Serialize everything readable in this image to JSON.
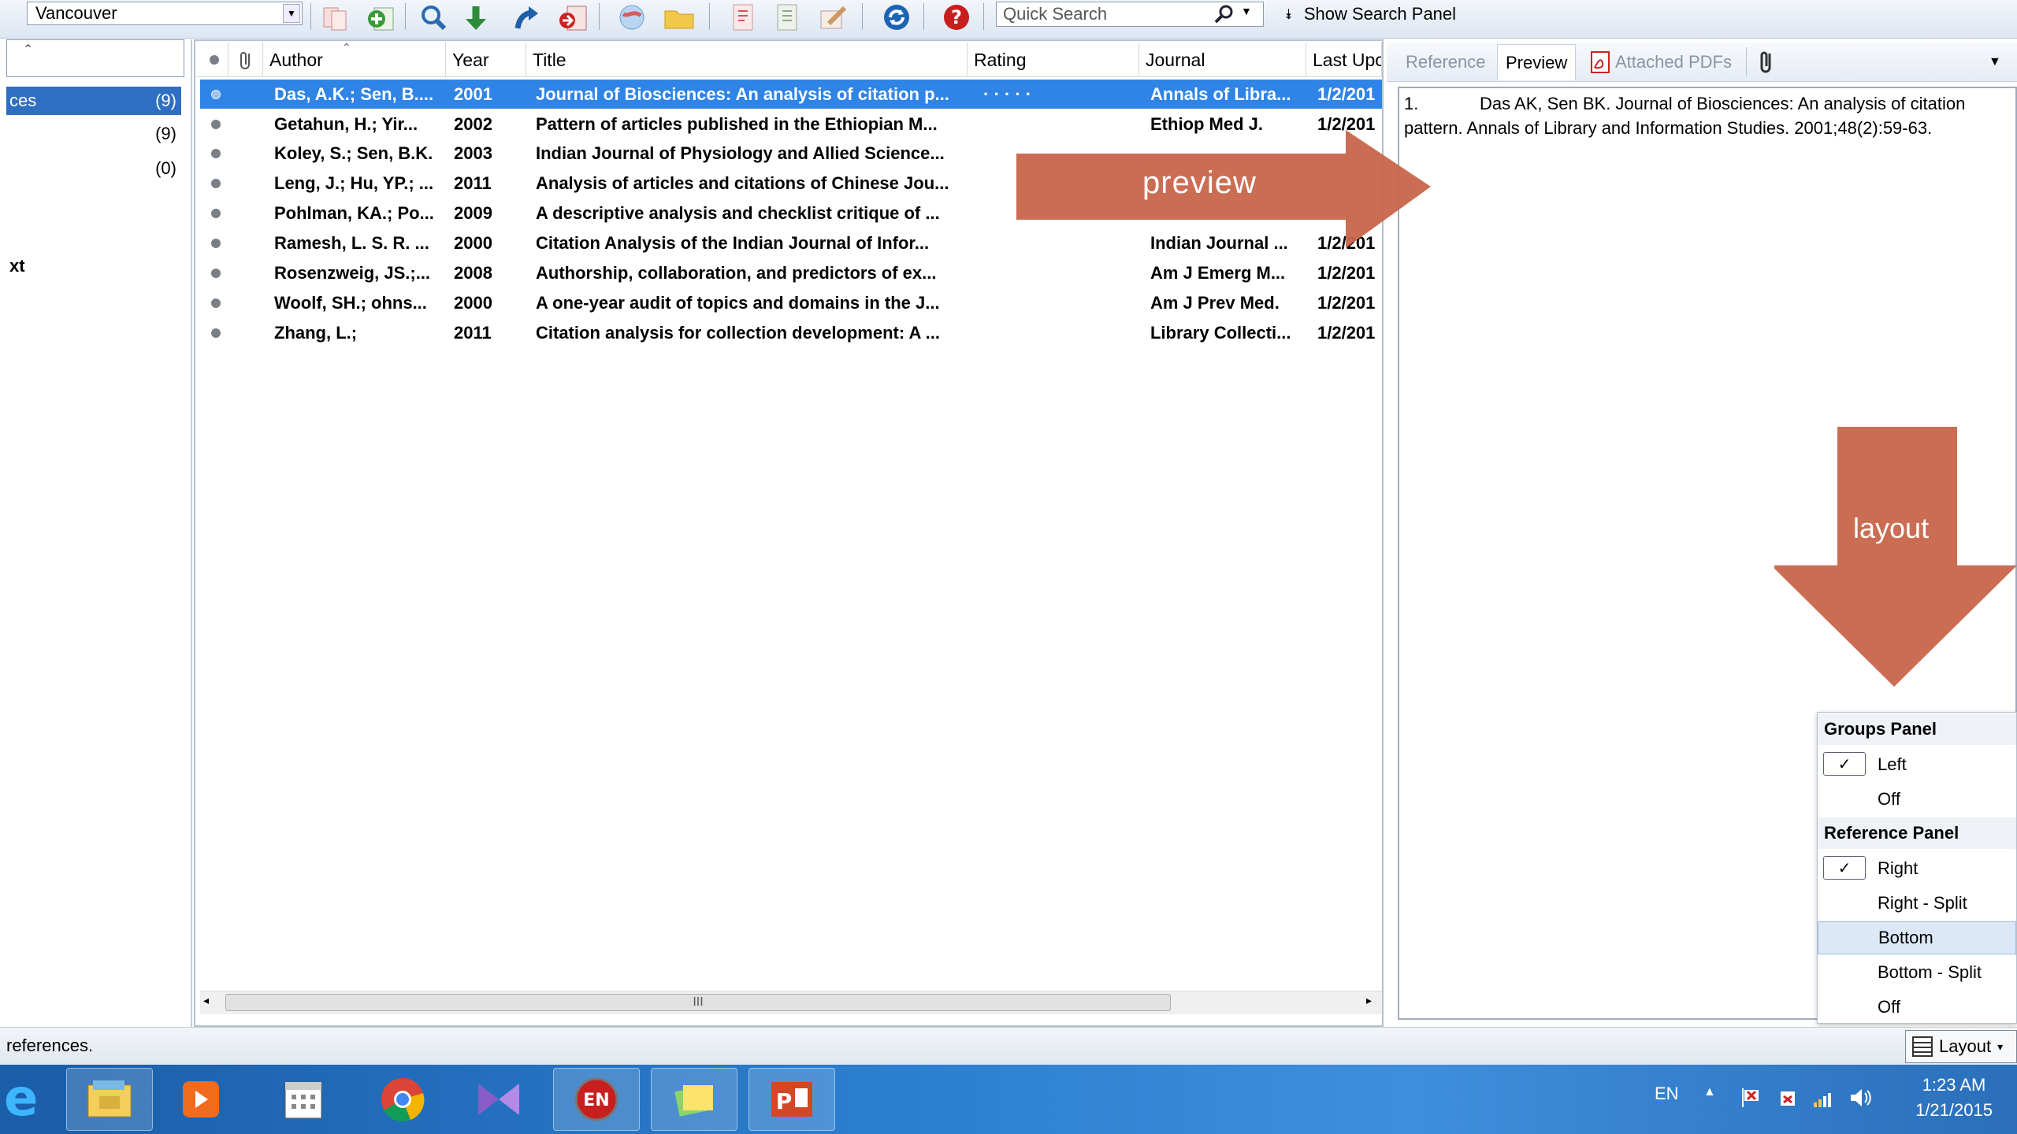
{
  "toolbar": {
    "style_value": "Vancouver",
    "quick_search_placeholder": "Quick Search",
    "show_search_label": "Show Search Panel",
    "icons": [
      "copy-icon",
      "add-reference-icon",
      "online-search-icon",
      "import-icon",
      "export-icon",
      "insert-citation-icon",
      "web-icon",
      "folder-icon",
      "open-pdf-icon",
      "format-bibliography-icon",
      "edit-icon",
      "sync-icon",
      "help-icon"
    ]
  },
  "groups": {
    "items": [
      {
        "label": "ces",
        "count": "(9)"
      },
      {
        "label": "",
        "count": "(9)"
      },
      {
        "label": "",
        "count": "(0)"
      },
      {
        "label": "xt",
        "count": ""
      }
    ]
  },
  "list": {
    "columns": {
      "author": "Author",
      "year": "Year",
      "title": "Title",
      "rating": "Rating",
      "journal": "Journal",
      "last_updated": "Last Upc"
    },
    "rows": [
      {
        "author": "Das, A.K.; Sen, B....",
        "year": "2001",
        "title": "Journal of Biosciences: An analysis of citation p...",
        "rating": "·  ·  ·  ·  ·",
        "journal": "Annals of Libra...",
        "updated": "1/2/201"
      },
      {
        "author": "Getahun, H.; Yir...",
        "year": "2002",
        "title": "Pattern of articles published in the Ethiopian M...",
        "rating": "",
        "journal": "Ethiop Med J.",
        "updated": "1/2/201"
      },
      {
        "author": "Koley, S.; Sen, B.K.",
        "year": "2003",
        "title": "Indian Journal of Physiology and Allied Science...",
        "rating": "",
        "journal": "",
        "updated": ""
      },
      {
        "author": "Leng, J.; Hu, YP.; ...",
        "year": "2011",
        "title": "Analysis of articles and citations of Chinese Jou...",
        "rating": "",
        "journal": "",
        "updated": ""
      },
      {
        "author": "Pohlman, KA.; Po...",
        "year": "2009",
        "title": "A descriptive analysis and checklist critique of ...",
        "rating": "",
        "journal": "",
        "updated": ""
      },
      {
        "author": "Ramesh, L. S. R. ...",
        "year": "2000",
        "title": "Citation Analysis of the Indian Journal of Infor...",
        "rating": "",
        "journal": "Indian Journal ...",
        "updated": "1/2/201"
      },
      {
        "author": "Rosenzweig, JS.;...",
        "year": "2008",
        "title": "Authorship, collaboration, and predictors of ex...",
        "rating": "",
        "journal": "Am J Emerg M...",
        "updated": "1/2/201"
      },
      {
        "author": "Woolf, SH.; ohns...",
        "year": "2000",
        "title": "A one-year audit of topics and domains in the J...",
        "rating": "",
        "journal": "Am J Prev Med.",
        "updated": "1/2/201"
      },
      {
        "author": "Zhang, L.;",
        "year": "2011",
        "title": "Citation analysis for collection development: A ...",
        "rating": "",
        "journal": "Library Collecti...",
        "updated": "1/2/201"
      }
    ],
    "scroll_thumb_label": "III"
  },
  "reference_panel": {
    "tabs": {
      "reference": "Reference",
      "preview": "Preview",
      "attached_pdfs": "Attached PDFs"
    },
    "preview_number": "1.",
    "preview_text": "Das AK, Sen BK. Journal of Biosciences: An analysis of citation pattern. Annals of Library and Information Studies. 2001;48(2):59-63."
  },
  "annotations": {
    "preview_label": "preview",
    "layout_label": "layout",
    "arrow_color": "#c8654a"
  },
  "layout_menu": {
    "groups_header": "Groups Panel",
    "groups_items": [
      "Left",
      "Off"
    ],
    "reference_header": "Reference Panel",
    "reference_items": [
      "Right",
      "Right - Split",
      "Bottom",
      "Bottom - Split",
      "Off"
    ],
    "checked": [
      "Left",
      "Right"
    ],
    "highlighted": "Bottom"
  },
  "status": {
    "text": "references.",
    "layout_button": "Layout"
  },
  "taskbar": {
    "apps": [
      "internet-explorer-icon",
      "file-explorer-icon",
      "media-player-icon",
      "calendar-icon",
      "chrome-icon",
      "visual-studio-icon",
      "endnote-icon",
      "sticky-notes-icon",
      "powerpoint-icon"
    ],
    "lang": "EN",
    "time": "1:23 AM",
    "date": "1/21/2015"
  }
}
